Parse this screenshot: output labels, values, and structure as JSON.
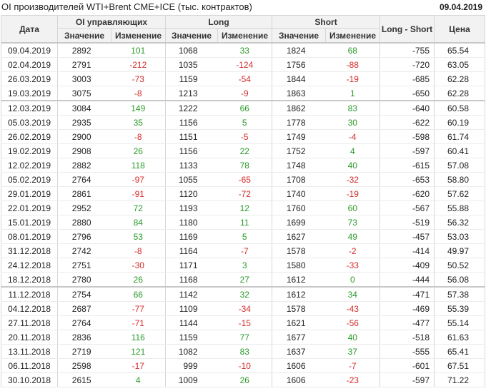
{
  "header": {
    "title": "OI производителей WTI+Brent CME+ICE (тыс. контрактов)",
    "date": "09.04.2019"
  },
  "columns": {
    "date": "Дата",
    "oi_group": "OI управляющих",
    "long_group": "Long",
    "short_group": "Short",
    "long_short": "Long - Short",
    "price": "Цена",
    "value": "Значение",
    "change": "Изменение"
  },
  "colors": {
    "positive": "#2a9a2a",
    "negative": "#d62c2c"
  },
  "rows": [
    {
      "date": "09.04.2019",
      "oi": "2892",
      "oi_chg": "101",
      "long": "1068",
      "long_chg": "33",
      "short": "1824",
      "short_chg": "68",
      "ls": "-755",
      "price": "65.54"
    },
    {
      "date": "02.04.2019",
      "oi": "2791",
      "oi_chg": "-212",
      "long": "1035",
      "long_chg": "-124",
      "short": "1756",
      "short_chg": "-88",
      "ls": "-720",
      "price": "63.05"
    },
    {
      "date": "26.03.2019",
      "oi": "3003",
      "oi_chg": "-73",
      "long": "1159",
      "long_chg": "-54",
      "short": "1844",
      "short_chg": "-19",
      "ls": "-685",
      "price": "62.28"
    },
    {
      "date": "19.03.2019",
      "oi": "3075",
      "oi_chg": "-8",
      "long": "1213",
      "long_chg": "-9",
      "short": "1863",
      "short_chg": "1",
      "ls": "-650",
      "price": "62.28"
    },
    {
      "date": "12.03.2019",
      "oi": "3084",
      "oi_chg": "149",
      "long": "1222",
      "long_chg": "66",
      "short": "1862",
      "short_chg": "83",
      "ls": "-640",
      "price": "60.58"
    },
    {
      "date": "05.03.2019",
      "oi": "2935",
      "oi_chg": "35",
      "long": "1156",
      "long_chg": "5",
      "short": "1778",
      "short_chg": "30",
      "ls": "-622",
      "price": "60.19"
    },
    {
      "date": "26.02.2019",
      "oi": "2900",
      "oi_chg": "-8",
      "long": "1151",
      "long_chg": "-5",
      "short": "1749",
      "short_chg": "-4",
      "ls": "-598",
      "price": "61.74"
    },
    {
      "date": "19.02.2019",
      "oi": "2908",
      "oi_chg": "26",
      "long": "1156",
      "long_chg": "22",
      "short": "1752",
      "short_chg": "4",
      "ls": "-597",
      "price": "60.41"
    },
    {
      "date": "12.02.2019",
      "oi": "2882",
      "oi_chg": "118",
      "long": "1133",
      "long_chg": "78",
      "short": "1748",
      "short_chg": "40",
      "ls": "-615",
      "price": "57.08"
    },
    {
      "date": "05.02.2019",
      "oi": "2764",
      "oi_chg": "-97",
      "long": "1055",
      "long_chg": "-65",
      "short": "1708",
      "short_chg": "-32",
      "ls": "-653",
      "price": "58.80"
    },
    {
      "date": "29.01.2019",
      "oi": "2861",
      "oi_chg": "-91",
      "long": "1120",
      "long_chg": "-72",
      "short": "1740",
      "short_chg": "-19",
      "ls": "-620",
      "price": "57.62"
    },
    {
      "date": "22.01.2019",
      "oi": "2952",
      "oi_chg": "72",
      "long": "1193",
      "long_chg": "12",
      "short": "1760",
      "short_chg": "60",
      "ls": "-567",
      "price": "55.88"
    },
    {
      "date": "15.01.2019",
      "oi": "2880",
      "oi_chg": "84",
      "long": "1180",
      "long_chg": "11",
      "short": "1699",
      "short_chg": "73",
      "ls": "-519",
      "price": "56.32"
    },
    {
      "date": "08.01.2019",
      "oi": "2796",
      "oi_chg": "53",
      "long": "1169",
      "long_chg": "5",
      "short": "1627",
      "short_chg": "49",
      "ls": "-457",
      "price": "53.03"
    },
    {
      "date": "31.12.2018",
      "oi": "2742",
      "oi_chg": "-8",
      "long": "1164",
      "long_chg": "-7",
      "short": "1578",
      "short_chg": "-2",
      "ls": "-414",
      "price": "49.97"
    },
    {
      "date": "24.12.2018",
      "oi": "2751",
      "oi_chg": "-30",
      "long": "1171",
      "long_chg": "3",
      "short": "1580",
      "short_chg": "-33",
      "ls": "-409",
      "price": "50.52"
    },
    {
      "date": "18.12.2018",
      "oi": "2780",
      "oi_chg": "26",
      "long": "1168",
      "long_chg": "27",
      "short": "1612",
      "short_chg": "0",
      "ls": "-444",
      "price": "56.08"
    },
    {
      "date": "11.12.2018",
      "oi": "2754",
      "oi_chg": "66",
      "long": "1142",
      "long_chg": "32",
      "short": "1612",
      "short_chg": "34",
      "ls": "-471",
      "price": "57.38"
    },
    {
      "date": "04.12.2018",
      "oi": "2687",
      "oi_chg": "-77",
      "long": "1109",
      "long_chg": "-34",
      "short": "1578",
      "short_chg": "-43",
      "ls": "-469",
      "price": "55.39"
    },
    {
      "date": "27.11.2018",
      "oi": "2764",
      "oi_chg": "-71",
      "long": "1144",
      "long_chg": "-15",
      "short": "1621",
      "short_chg": "-56",
      "ls": "-477",
      "price": "55.14"
    },
    {
      "date": "20.11.2018",
      "oi": "2836",
      "oi_chg": "116",
      "long": "1159",
      "long_chg": "77",
      "short": "1677",
      "short_chg": "40",
      "ls": "-518",
      "price": "61.63"
    },
    {
      "date": "13.11.2018",
      "oi": "2719",
      "oi_chg": "121",
      "long": "1082",
      "long_chg": "83",
      "short": "1637",
      "short_chg": "37",
      "ls": "-555",
      "price": "65.41"
    },
    {
      "date": "06.11.2018",
      "oi": "2598",
      "oi_chg": "-17",
      "long": "999",
      "long_chg": "-10",
      "short": "1606",
      "short_chg": "-7",
      "ls": "-601",
      "price": "67.51"
    },
    {
      "date": "30.10.2018",
      "oi": "2615",
      "oi_chg": "4",
      "long": "1009",
      "long_chg": "26",
      "short": "1606",
      "short_chg": "-23",
      "ls": "-597",
      "price": "71.22"
    }
  ]
}
